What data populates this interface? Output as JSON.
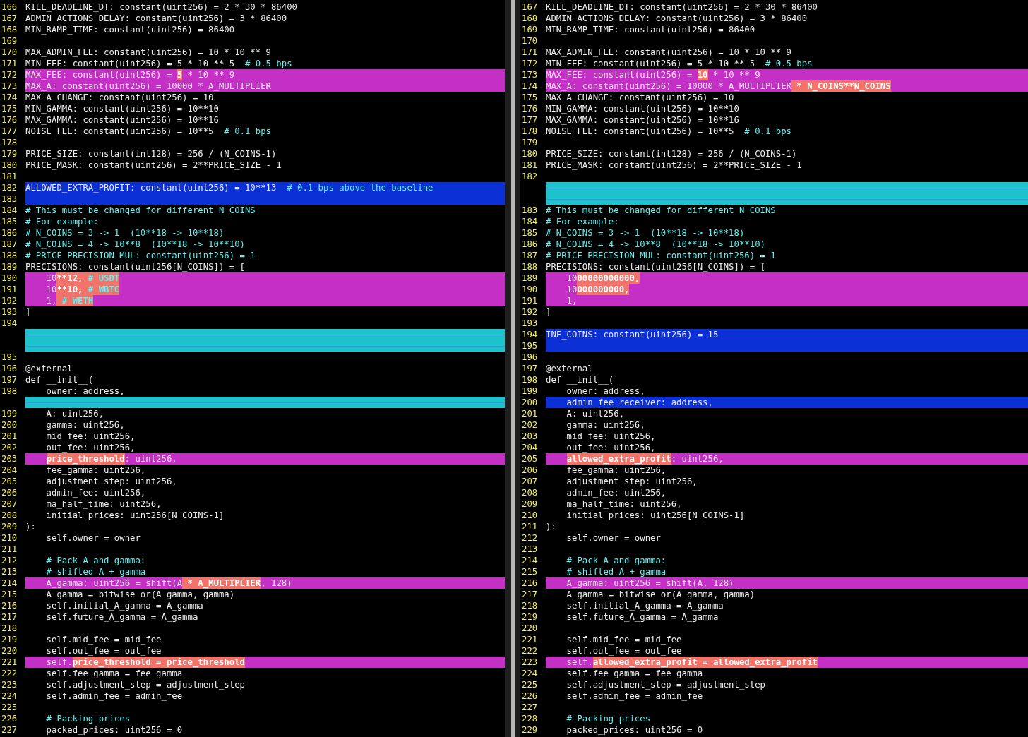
{
  "panes": [
    {
      "lines": [
        {
          "number": "166",
          "kind": "normal",
          "segments": [
            {
              "text": "KILL_DEADLINE_DT: constant(uint256) = 2 * 30 * 86400",
              "kind": "code"
            }
          ]
        },
        {
          "number": "167",
          "kind": "normal",
          "segments": [
            {
              "text": "ADMIN_ACTIONS_DELAY: constant(uint256) = 3 * 86400",
              "kind": "code"
            }
          ]
        },
        {
          "number": "168",
          "kind": "normal",
          "segments": [
            {
              "text": "MIN_RAMP_TIME: constant(uint256) = 86400",
              "kind": "code"
            }
          ]
        },
        {
          "number": "169",
          "kind": "normal"
        },
        {
          "number": "170",
          "kind": "normal",
          "segments": [
            {
              "text": "MAX_ADMIN_FEE: constant(uint256) = 10 * 10 ** 9",
              "kind": "code"
            }
          ]
        },
        {
          "number": "171",
          "kind": "normal",
          "segments": [
            {
              "text": "MIN_FEE: constant(uint256) = 5 * 10 ** 5  ",
              "kind": "code"
            },
            {
              "text": "# 0.5 bps",
              "kind": "comment"
            }
          ]
        },
        {
          "number": "172",
          "kind": "changed",
          "segments": [
            {
              "text": "MAX_FEE: constant(uint256) = ",
              "kind": "code"
            },
            {
              "text": "5",
              "kind": "diff"
            },
            {
              "text": " * 10 ** 9",
              "kind": "code"
            }
          ]
        },
        {
          "number": "173",
          "kind": "changed",
          "segments": [
            {
              "text": "MAX_A: constant(uint256) = 10000 * A_MULTIPLIER",
              "kind": "code"
            }
          ]
        },
        {
          "number": "174",
          "kind": "normal",
          "segments": [
            {
              "text": "MAX_A_CHANGE: constant(uint256) = 10",
              "kind": "code"
            }
          ]
        },
        {
          "number": "175",
          "kind": "normal",
          "segments": [
            {
              "text": "MIN_GAMMA: constant(uint256) = 10**10",
              "kind": "code"
            }
          ]
        },
        {
          "number": "176",
          "kind": "normal",
          "segments": [
            {
              "text": "MAX_GAMMA: constant(uint256) = 10**16",
              "kind": "code"
            }
          ]
        },
        {
          "number": "177",
          "kind": "normal",
          "segments": [
            {
              "text": "NOISE_FEE: constant(uint256) = 10**5  ",
              "kind": "code"
            },
            {
              "text": "# 0.1 bps",
              "kind": "comment"
            }
          ]
        },
        {
          "number": "178",
          "kind": "normal"
        },
        {
          "number": "179",
          "kind": "normal",
          "segments": [
            {
              "text": "PRICE_SIZE: constant(int128) = 256 / (N_COINS-1)",
              "kind": "code"
            }
          ]
        },
        {
          "number": "180",
          "kind": "normal",
          "segments": [
            {
              "text": "PRICE_MASK: constant(uint256) = 2**PRICE_SIZE - 1",
              "kind": "code"
            }
          ]
        },
        {
          "number": "181",
          "kind": "normal"
        },
        {
          "number": "182",
          "kind": "added",
          "segments": [
            {
              "text": "ALLOWED_EXTRA_PROFIT: constant(uint256) = 10**13  ",
              "kind": "code"
            },
            {
              "text": "# 0.1 bps above the baseline",
              "kind": "comment"
            }
          ]
        },
        {
          "number": "183",
          "kind": "added"
        },
        {
          "number": "184",
          "kind": "normal",
          "segments": [
            {
              "text": "# This must be changed for different N_COINS",
              "kind": "comment"
            }
          ]
        },
        {
          "number": "185",
          "kind": "normal",
          "segments": [
            {
              "text": "# For example:",
              "kind": "comment"
            }
          ]
        },
        {
          "number": "186",
          "kind": "normal",
          "segments": [
            {
              "text": "# N_COINS = 3 -> 1  (10**18 -> 10**18)",
              "kind": "comment"
            }
          ]
        },
        {
          "number": "187",
          "kind": "normal",
          "segments": [
            {
              "text": "# N_COINS = 4 -> 10**8  (10**18 -> 10**10)",
              "kind": "comment"
            }
          ]
        },
        {
          "number": "188",
          "kind": "normal",
          "segments": [
            {
              "text": "# PRICE_PRECISION_MUL: constant(uint256) = 1",
              "kind": "comment"
            }
          ]
        },
        {
          "number": "189",
          "kind": "normal",
          "segments": [
            {
              "text": "PRECISIONS: constant(uint256[N_COINS]) = [",
              "kind": "code"
            }
          ]
        },
        {
          "number": "190",
          "kind": "changed",
          "segments": [
            {
              "text": "    10",
              "kind": "code"
            },
            {
              "text": "**12, ",
              "kind": "diff"
            },
            {
              "text": "# USDT",
              "kind": "diff-comment"
            }
          ]
        },
        {
          "number": "191",
          "kind": "changed",
          "segments": [
            {
              "text": "    10",
              "kind": "code"
            },
            {
              "text": "**10, ",
              "kind": "diff"
            },
            {
              "text": "# WBTC",
              "kind": "diff-comment"
            }
          ]
        },
        {
          "number": "192",
          "kind": "changed",
          "segments": [
            {
              "text": "    1,",
              "kind": "code"
            },
            {
              "text": " # WETH",
              "kind": "diff-comment"
            }
          ]
        },
        {
          "number": "193",
          "kind": "normal",
          "segments": [
            {
              "text": "]",
              "kind": "code"
            }
          ]
        },
        {
          "number": "194",
          "kind": "normal"
        },
        {
          "kind": "filler"
        },
        {
          "kind": "filler"
        },
        {
          "number": "195",
          "kind": "normal"
        },
        {
          "number": "196",
          "kind": "normal",
          "segments": [
            {
              "text": "@external",
              "kind": "code"
            }
          ]
        },
        {
          "number": "197",
          "kind": "normal",
          "segments": [
            {
              "text": "def __init__(",
              "kind": "code"
            }
          ]
        },
        {
          "number": "198",
          "kind": "normal",
          "segments": [
            {
              "text": "    owner: address,",
              "kind": "code"
            }
          ]
        },
        {
          "kind": "filler"
        },
        {
          "number": "199",
          "kind": "normal",
          "segments": [
            {
              "text": "    A: uint256,",
              "kind": "code"
            }
          ]
        },
        {
          "number": "200",
          "kind": "normal",
          "segments": [
            {
              "text": "    gamma: uint256,",
              "kind": "code"
            }
          ]
        },
        {
          "number": "201",
          "kind": "normal",
          "segments": [
            {
              "text": "    mid_fee: uint256,",
              "kind": "code"
            }
          ]
        },
        {
          "number": "202",
          "kind": "normal",
          "segments": [
            {
              "text": "    out_fee: uint256,",
              "kind": "code"
            }
          ]
        },
        {
          "number": "203",
          "kind": "changed",
          "segments": [
            {
              "text": "    price_threshold",
              "kind": "diff"
            },
            {
              "text": ": uint256,",
              "kind": "code"
            }
          ]
        },
        {
          "number": "204",
          "kind": "normal",
          "segments": [
            {
              "text": "    fee_gamma: uint256,",
              "kind": "code"
            }
          ]
        },
        {
          "number": "205",
          "kind": "normal",
          "segments": [
            {
              "text": "    adjustment_step: uint256,",
              "kind": "code"
            }
          ]
        },
        {
          "number": "206",
          "kind": "normal",
          "segments": [
            {
              "text": "    admin_fee: uint256,",
              "kind": "code"
            }
          ]
        },
        {
          "number": "207",
          "kind": "normal",
          "segments": [
            {
              "text": "    ma_half_time: uint256,",
              "kind": "code"
            }
          ]
        },
        {
          "number": "208",
          "kind": "normal",
          "segments": [
            {
              "text": "    initial_prices: uint256[N_COINS-1]",
              "kind": "code"
            }
          ]
        },
        {
          "number": "209",
          "kind": "normal",
          "segments": [
            {
              "text": "):",
              "kind": "code"
            }
          ]
        },
        {
          "number": "210",
          "kind": "normal",
          "segments": [
            {
              "text": "    self.owner = owner",
              "kind": "code"
            }
          ]
        },
        {
          "number": "211",
          "kind": "normal"
        },
        {
          "number": "212",
          "kind": "normal",
          "segments": [
            {
              "text": "    # Pack A and gamma:",
              "kind": "comment"
            }
          ]
        },
        {
          "number": "213",
          "kind": "normal",
          "segments": [
            {
              "text": "    # shifted A + gamma",
              "kind": "comment"
            }
          ]
        },
        {
          "number": "214",
          "kind": "changed",
          "segments": [
            {
              "text": "    A_gamma: uint256 = shift(A",
              "kind": "code"
            },
            {
              "text": " * A_MULTIPLIER",
              "kind": "diff"
            },
            {
              "text": ", 128)",
              "kind": "code"
            }
          ]
        },
        {
          "number": "215",
          "kind": "normal",
          "segments": [
            {
              "text": "    A_gamma = bitwise_or(A_gamma, gamma)",
              "kind": "code"
            }
          ]
        },
        {
          "number": "216",
          "kind": "normal",
          "segments": [
            {
              "text": "    self.initial_A_gamma = A_gamma",
              "kind": "code"
            }
          ]
        },
        {
          "number": "217",
          "kind": "normal",
          "segments": [
            {
              "text": "    self.future_A_gamma = A_gamma",
              "kind": "code"
            }
          ]
        },
        {
          "number": "218",
          "kind": "normal"
        },
        {
          "number": "219",
          "kind": "normal",
          "segments": [
            {
              "text": "    self.mid_fee = mid_fee",
              "kind": "code"
            }
          ]
        },
        {
          "number": "220",
          "kind": "normal",
          "segments": [
            {
              "text": "    self.out_fee = out_fee",
              "kind": "code"
            }
          ]
        },
        {
          "number": "221",
          "kind": "changed",
          "segments": [
            {
              "text": "    self.",
              "kind": "code"
            },
            {
              "text": "price_threshold = price_threshold",
              "kind": "diff"
            }
          ]
        },
        {
          "number": "222",
          "kind": "normal",
          "segments": [
            {
              "text": "    self.fee_gamma = fee_gamma",
              "kind": "code"
            }
          ]
        },
        {
          "number": "223",
          "kind": "normal",
          "segments": [
            {
              "text": "    self.adjustment_step = adjustment_step",
              "kind": "code"
            }
          ]
        },
        {
          "number": "224",
          "kind": "normal",
          "segments": [
            {
              "text": "    self.admin_fee = admin_fee",
              "kind": "code"
            }
          ]
        },
        {
          "number": "225",
          "kind": "normal"
        },
        {
          "number": "226",
          "kind": "normal",
          "segments": [
            {
              "text": "    # Packing prices",
              "kind": "comment"
            }
          ]
        },
        {
          "number": "227",
          "kind": "normal",
          "segments": [
            {
              "text": "    packed_prices: uint256 = 0",
              "kind": "code"
            }
          ]
        }
      ]
    },
    {
      "lines": [
        {
          "number": "167",
          "kind": "normal",
          "segments": [
            {
              "text": "KILL_DEADLINE_DT: constant(uint256) = 2 * 30 * 86400",
              "kind": "code"
            }
          ]
        },
        {
          "number": "168",
          "kind": "normal",
          "segments": [
            {
              "text": "ADMIN_ACTIONS_DELAY: constant(uint256) = 3 * 86400",
              "kind": "code"
            }
          ]
        },
        {
          "number": "169",
          "kind": "normal",
          "segments": [
            {
              "text": "MIN_RAMP_TIME: constant(uint256) = 86400",
              "kind": "code"
            }
          ]
        },
        {
          "number": "170",
          "kind": "normal"
        },
        {
          "number": "171",
          "kind": "normal",
          "segments": [
            {
              "text": "MAX_ADMIN_FEE: constant(uint256) = 10 * 10 ** 9",
              "kind": "code"
            }
          ]
        },
        {
          "number": "172",
          "kind": "normal",
          "segments": [
            {
              "text": "MIN_FEE: constant(uint256) = 5 * 10 ** 5  ",
              "kind": "code"
            },
            {
              "text": "# 0.5 bps",
              "kind": "comment"
            }
          ]
        },
        {
          "number": "173",
          "kind": "changed",
          "segments": [
            {
              "text": "MAX_FEE: constant(uint256) = ",
              "kind": "code"
            },
            {
              "text": "10",
              "kind": "diff"
            },
            {
              "text": " * 10 ** 9",
              "kind": "code"
            }
          ]
        },
        {
          "number": "174",
          "kind": "changed",
          "segments": [
            {
              "text": "MAX_A: constant(uint256) = 10000 * A_MULTIPLIER",
              "kind": "code"
            },
            {
              "text": " * N_COINS**N_COINS",
              "kind": "diff"
            }
          ]
        },
        {
          "number": "175",
          "kind": "normal",
          "segments": [
            {
              "text": "MAX_A_CHANGE: constant(uint256) = 10",
              "kind": "code"
            }
          ]
        },
        {
          "number": "176",
          "kind": "normal",
          "segments": [
            {
              "text": "MIN_GAMMA: constant(uint256) = 10**10",
              "kind": "code"
            }
          ]
        },
        {
          "number": "177",
          "kind": "normal",
          "segments": [
            {
              "text": "MAX_GAMMA: constant(uint256) = 10**16",
              "kind": "code"
            }
          ]
        },
        {
          "number": "178",
          "kind": "normal",
          "segments": [
            {
              "text": "NOISE_FEE: constant(uint256) = 10**5  ",
              "kind": "code"
            },
            {
              "text": "# 0.1 bps",
              "kind": "comment"
            }
          ]
        },
        {
          "number": "179",
          "kind": "normal"
        },
        {
          "number": "180",
          "kind": "normal",
          "segments": [
            {
              "text": "PRICE_SIZE: constant(int128) = 256 / (N_COINS-1)",
              "kind": "code"
            }
          ]
        },
        {
          "number": "181",
          "kind": "normal",
          "segments": [
            {
              "text": "PRICE_MASK: constant(uint256) = 2**PRICE_SIZE - 1",
              "kind": "code"
            }
          ]
        },
        {
          "number": "182",
          "kind": "normal"
        },
        {
          "kind": "filler"
        },
        {
          "kind": "filler"
        },
        {
          "number": "183",
          "kind": "normal",
          "segments": [
            {
              "text": "# This must be changed for different N_COINS",
              "kind": "comment"
            }
          ]
        },
        {
          "number": "184",
          "kind": "normal",
          "segments": [
            {
              "text": "# For example:",
              "kind": "comment"
            }
          ]
        },
        {
          "number": "185",
          "kind": "normal",
          "segments": [
            {
              "text": "# N_COINS = 3 -> 1  (10**18 -> 10**18)",
              "kind": "comment"
            }
          ]
        },
        {
          "number": "186",
          "kind": "normal",
          "segments": [
            {
              "text": "# N_COINS = 4 -> 10**8  (10**18 -> 10**10)",
              "kind": "comment"
            }
          ]
        },
        {
          "number": "187",
          "kind": "normal",
          "segments": [
            {
              "text": "# PRICE_PRECISION_MUL: constant(uint256) = 1",
              "kind": "comment"
            }
          ]
        },
        {
          "number": "188",
          "kind": "normal",
          "segments": [
            {
              "text": "PRECISIONS: constant(uint256[N_COINS]) = [",
              "kind": "code"
            }
          ]
        },
        {
          "number": "189",
          "kind": "changed",
          "segments": [
            {
              "text": "    10",
              "kind": "code"
            },
            {
              "text": "00000000000,",
              "kind": "diff"
            }
          ]
        },
        {
          "number": "190",
          "kind": "changed",
          "segments": [
            {
              "text": "    10",
              "kind": "code"
            },
            {
              "text": "000000000,",
              "kind": "diff"
            }
          ]
        },
        {
          "number": "191",
          "kind": "changed",
          "segments": [
            {
              "text": "    1,",
              "kind": "code"
            }
          ]
        },
        {
          "number": "192",
          "kind": "normal",
          "segments": [
            {
              "text": "]",
              "kind": "code"
            }
          ]
        },
        {
          "number": "193",
          "kind": "normal"
        },
        {
          "number": "194",
          "kind": "added",
          "segments": [
            {
              "text": "INF_COINS: constant(uint256) = 15",
              "kind": "code"
            }
          ]
        },
        {
          "number": "195",
          "kind": "added"
        },
        {
          "number": "196",
          "kind": "normal"
        },
        {
          "number": "197",
          "kind": "normal",
          "segments": [
            {
              "text": "@external",
              "kind": "code"
            }
          ]
        },
        {
          "number": "198",
          "kind": "normal",
          "segments": [
            {
              "text": "def __init__(",
              "kind": "code"
            }
          ]
        },
        {
          "number": "199",
          "kind": "normal",
          "segments": [
            {
              "text": "    owner: address,",
              "kind": "code"
            }
          ]
        },
        {
          "number": "200",
          "kind": "added",
          "segments": [
            {
              "text": "    admin_fee_receiver: address,",
              "kind": "code"
            }
          ]
        },
        {
          "number": "201",
          "kind": "normal",
          "segments": [
            {
              "text": "    A: uint256,",
              "kind": "code"
            }
          ]
        },
        {
          "number": "202",
          "kind": "normal",
          "segments": [
            {
              "text": "    gamma: uint256,",
              "kind": "code"
            }
          ]
        },
        {
          "number": "203",
          "kind": "normal",
          "segments": [
            {
              "text": "    mid_fee: uint256,",
              "kind": "code"
            }
          ]
        },
        {
          "number": "204",
          "kind": "normal",
          "segments": [
            {
              "text": "    out_fee: uint256,",
              "kind": "code"
            }
          ]
        },
        {
          "number": "205",
          "kind": "changed",
          "segments": [
            {
              "text": "    allowed_extra_profit",
              "kind": "diff"
            },
            {
              "text": ": uint256,",
              "kind": "code"
            }
          ]
        },
        {
          "number": "206",
          "kind": "normal",
          "segments": [
            {
              "text": "    fee_gamma: uint256,",
              "kind": "code"
            }
          ]
        },
        {
          "number": "207",
          "kind": "normal",
          "segments": [
            {
              "text": "    adjustment_step: uint256,",
              "kind": "code"
            }
          ]
        },
        {
          "number": "208",
          "kind": "normal",
          "segments": [
            {
              "text": "    admin_fee: uint256,",
              "kind": "code"
            }
          ]
        },
        {
          "number": "209",
          "kind": "normal",
          "segments": [
            {
              "text": "    ma_half_time: uint256,",
              "kind": "code"
            }
          ]
        },
        {
          "number": "210",
          "kind": "normal",
          "segments": [
            {
              "text": "    initial_prices: uint256[N_COINS-1]",
              "kind": "code"
            }
          ]
        },
        {
          "number": "211",
          "kind": "normal",
          "segments": [
            {
              "text": "):",
              "kind": "code"
            }
          ]
        },
        {
          "number": "212",
          "kind": "normal",
          "segments": [
            {
              "text": "    self.owner = owner",
              "kind": "code"
            }
          ]
        },
        {
          "number": "213",
          "kind": "normal"
        },
        {
          "number": "214",
          "kind": "normal",
          "segments": [
            {
              "text": "    # Pack A and gamma:",
              "kind": "comment"
            }
          ]
        },
        {
          "number": "215",
          "kind": "normal",
          "segments": [
            {
              "text": "    # shifted A + gamma",
              "kind": "comment"
            }
          ]
        },
        {
          "number": "216",
          "kind": "changed",
          "segments": [
            {
              "text": "    A_gamma: uint256 = shift(A, 128)",
              "kind": "code"
            }
          ]
        },
        {
          "number": "217",
          "kind": "normal",
          "segments": [
            {
              "text": "    A_gamma = bitwise_or(A_gamma, gamma)",
              "kind": "code"
            }
          ]
        },
        {
          "number": "218",
          "kind": "normal",
          "segments": [
            {
              "text": "    self.initial_A_gamma = A_gamma",
              "kind": "code"
            }
          ]
        },
        {
          "number": "219",
          "kind": "normal",
          "segments": [
            {
              "text": "    self.future_A_gamma = A_gamma",
              "kind": "code"
            }
          ]
        },
        {
          "number": "220",
          "kind": "normal"
        },
        {
          "number": "221",
          "kind": "normal",
          "segments": [
            {
              "text": "    self.mid_fee = mid_fee",
              "kind": "code"
            }
          ]
        },
        {
          "number": "222",
          "kind": "normal",
          "segments": [
            {
              "text": "    self.out_fee = out_fee",
              "kind": "code"
            }
          ]
        },
        {
          "number": "223",
          "kind": "changed",
          "segments": [
            {
              "text": "    self.",
              "kind": "code"
            },
            {
              "text": "allowed_extra_profit = allowed_extra_profit",
              "kind": "diff"
            }
          ]
        },
        {
          "number": "224",
          "kind": "normal",
          "segments": [
            {
              "text": "    self.fee_gamma = fee_gamma",
              "kind": "code"
            }
          ]
        },
        {
          "number": "225",
          "kind": "normal",
          "segments": [
            {
              "text": "    self.adjustment_step = adjustment_step",
              "kind": "code"
            }
          ]
        },
        {
          "number": "226",
          "kind": "normal",
          "segments": [
            {
              "text": "    self.admin_fee = admin_fee",
              "kind": "code"
            }
          ]
        },
        {
          "number": "227",
          "kind": "normal"
        },
        {
          "number": "228",
          "kind": "normal",
          "segments": [
            {
              "text": "    # Packing prices",
              "kind": "comment"
            }
          ]
        },
        {
          "number": "229",
          "kind": "normal",
          "segments": [
            {
              "text": "    packed_prices: uint256 = 0",
              "kind": "code"
            }
          ]
        }
      ]
    }
  ]
}
